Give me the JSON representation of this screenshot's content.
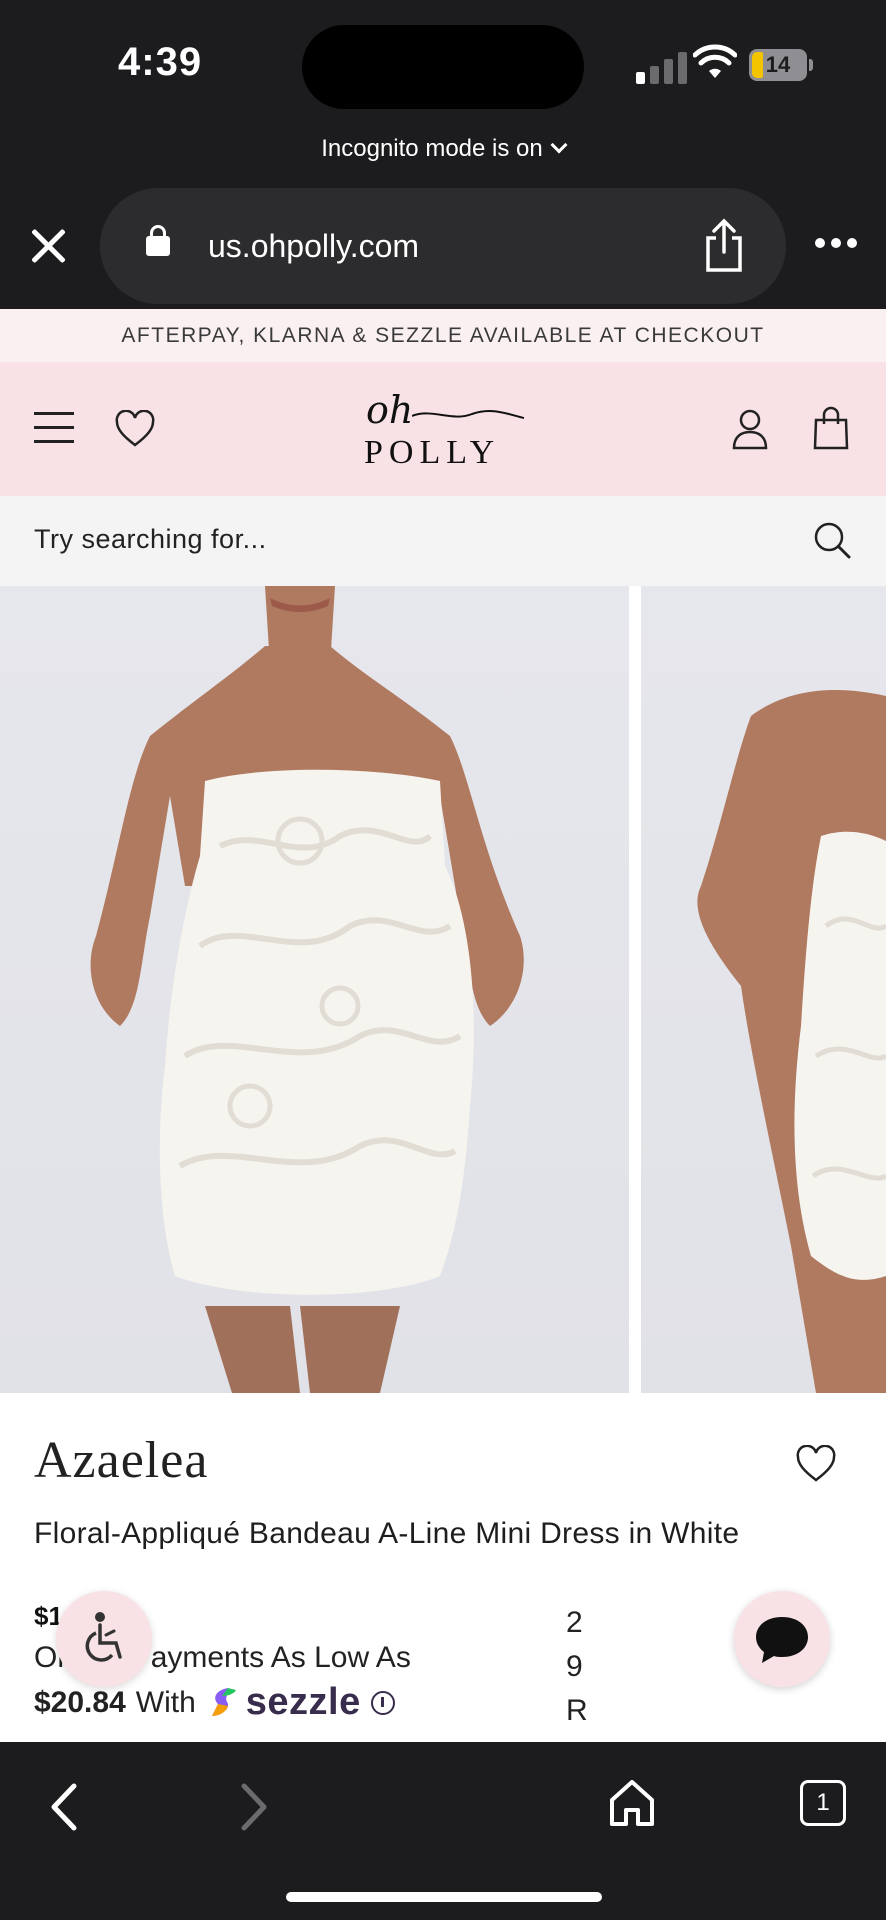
{
  "status_bar": {
    "time": "4:39",
    "battery": "14"
  },
  "browser": {
    "incognito_label": "Incognito mode is on",
    "url": "us.ohpolly.com",
    "tabs_count": "1"
  },
  "site": {
    "promo_banner": "AFTERPAY, KLARNA & SEZZLE AVAILABLE AT CHECKOUT",
    "logo": {
      "script": "oh",
      "wordmark": "POLLY"
    },
    "search_placeholder": "Try searching for...",
    "header_bg": "#f8e2e5"
  },
  "product": {
    "name": "Azaelea",
    "description": "Floral-Appliqué Bandeau A-Line Mini Dress in White",
    "price_partial": "$1",
    "payments_line1": "Or    thly Payments As Low As",
    "installment_amount": "$20.84",
    "payments_with": "With",
    "provider": "sezzle",
    "side_chars": [
      "2",
      "9",
      "R"
    ]
  },
  "icons": {
    "close": "close-icon",
    "lock": "lock-icon",
    "share": "share-icon",
    "more": "more-icon",
    "menu": "hamburger-icon",
    "wishlist": "heart-icon",
    "account": "account-icon",
    "bag": "shopping-bag-icon",
    "search": "search-icon",
    "accessibility": "accessibility-icon",
    "chat": "chat-icon",
    "back": "chevron-left-icon",
    "forward": "chevron-right-icon",
    "home": "home-icon"
  }
}
